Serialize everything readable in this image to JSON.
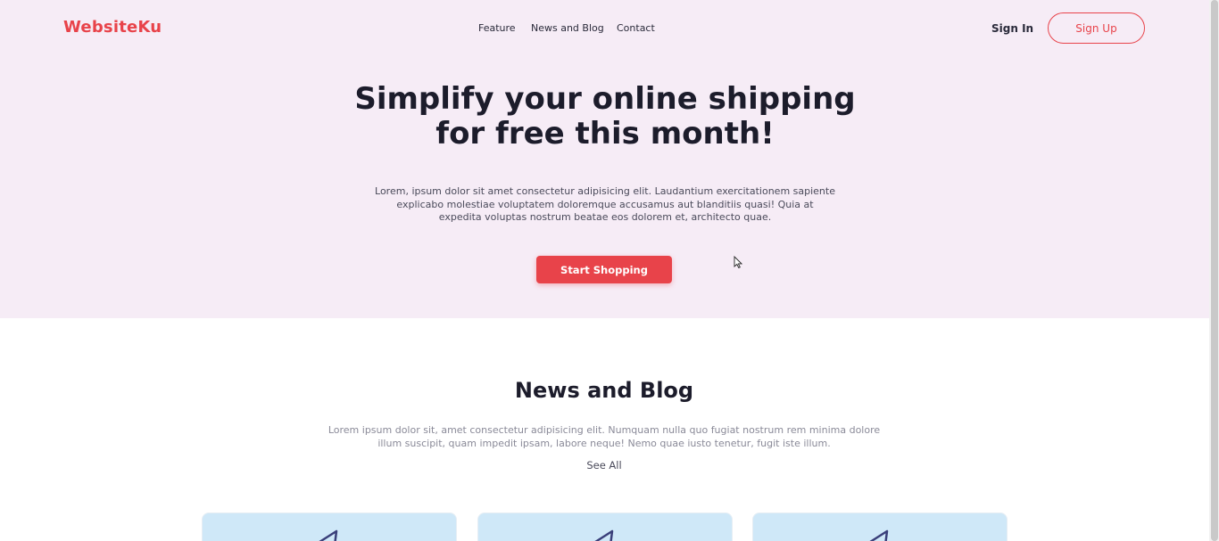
{
  "header": {
    "logo": "WebsiteKu",
    "nav": [
      "Feature",
      "News and Blog",
      "Contact"
    ],
    "sign_in": "Sign In",
    "sign_up": "Sign Up"
  },
  "hero": {
    "title": "Simplify your online shipping for free this month!",
    "text": "Lorem, ipsum dolor sit amet consectetur adipisicing elit. Laudantium exercitationem sapiente explicabo molestiae voluptatem doloremque accusamus aut blanditiis quasi! Quia at expedita voluptas nostrum beatae eos dolorem et, architecto quae.",
    "cta": "Start Shopping"
  },
  "news": {
    "title": "News and Blog",
    "text": "Lorem ipsum dolor sit, amet consectetur adipisicing elit. Numquam nulla quo fugiat nostrum rem minima dolore illum suscipit, quam impedit ipsam, labore neque! Nemo quae iusto tenetur, fugit iste illum.",
    "see_all": "See All"
  },
  "colors": {
    "accent": "#e8434a",
    "hero_bg": "#f6ecf6",
    "card_bg": "#cfe8f8"
  },
  "icons": [
    "cursor-arrow-icon",
    "paper-plane-icon"
  ]
}
